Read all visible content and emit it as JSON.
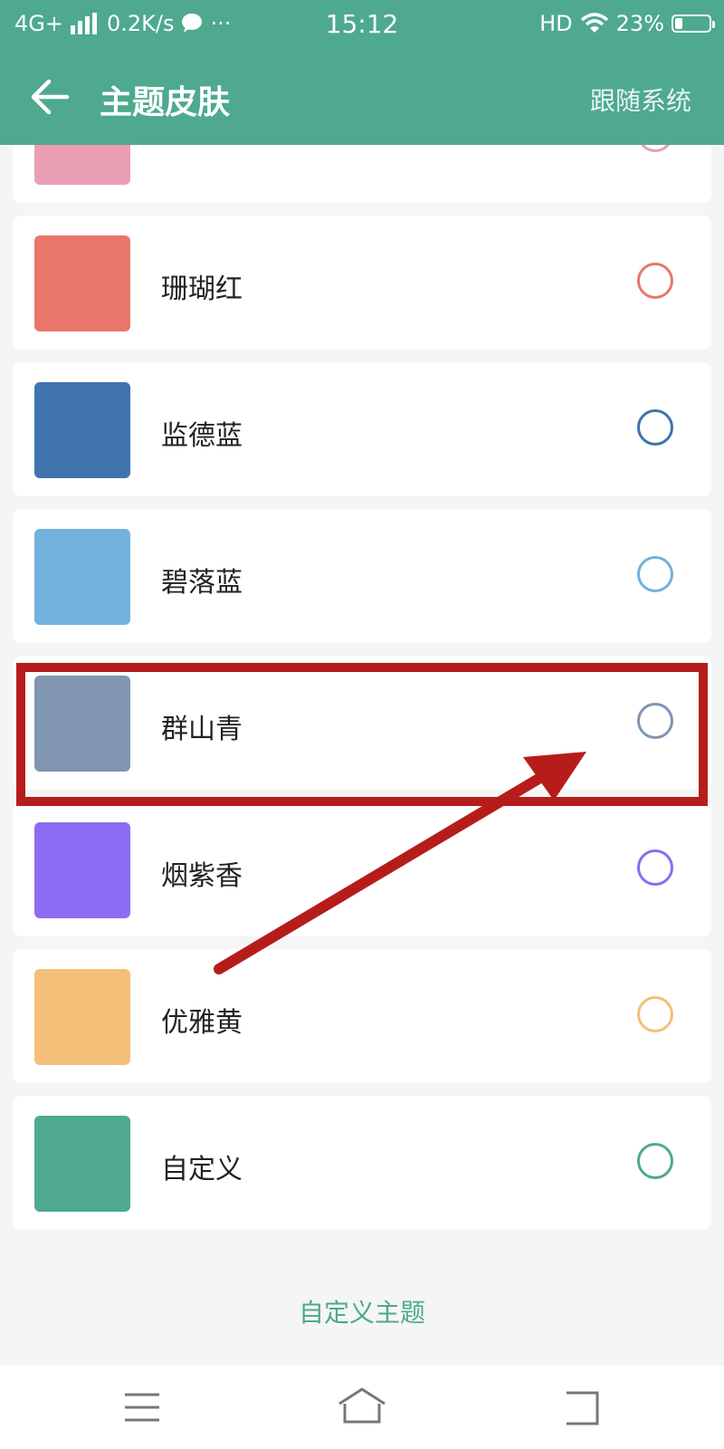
{
  "status_bar": {
    "network": "4G+",
    "speed": "0.2K/s",
    "more": "···",
    "time": "15:12",
    "hd": "HD",
    "battery": "23%",
    "battery_level": 0.23
  },
  "header": {
    "title": "主题皮肤",
    "follow_system": "跟随系统"
  },
  "themes": [
    {
      "label": "",
      "color": "#e99eb3"
    },
    {
      "label": "珊瑚红",
      "color": "#e8776a"
    },
    {
      "label": "监德蓝",
      "color": "#3f74ad"
    },
    {
      "label": "碧落蓝",
      "color": "#73b2dc"
    },
    {
      "label": "群山青",
      "color": "#7f95b0"
    },
    {
      "label": "烟紫香",
      "color": "#8c6cf3"
    },
    {
      "label": "优雅黄",
      "color": "#f4bf78"
    },
    {
      "label": "自定义",
      "color": "#4ea98f"
    }
  ],
  "custom_theme_link": "自定义主题",
  "colors": {
    "accent": "#4ea98f",
    "annotation": "#b61d1a"
  }
}
